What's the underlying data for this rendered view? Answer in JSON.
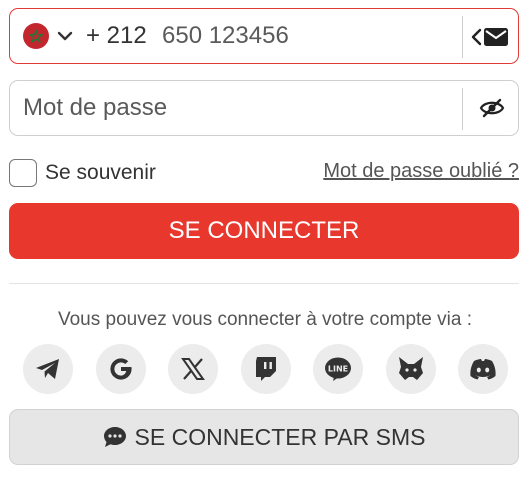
{
  "phone": {
    "country_flag_icon": "morocco-flag-icon",
    "country_code": "+ 212",
    "placeholder": "650 123456",
    "switch_icon": "chevron-left-envelope-icon"
  },
  "password": {
    "placeholder": "Mot de passe",
    "toggle_icon": "eye-off-icon"
  },
  "remember": {
    "label": "Se souvenir",
    "checked": false
  },
  "forgot_link": "Mot de passe oublié ?",
  "login_button": "SE CONNECTER",
  "social_prompt": "Vous pouvez vous connecter à votre compte via :",
  "socials": [
    "telegram-icon",
    "google-icon",
    "x-icon",
    "twitch-icon",
    "line-icon",
    "metamask-icon",
    "discord-icon"
  ],
  "sms_button": {
    "label": "SE CONNECTER PAR SMS",
    "icon": "chat-bubble-icon"
  },
  "colors": {
    "accent": "#e8372d",
    "border_active": "#e23b33",
    "social_bg": "#ececec",
    "sms_bg": "#e6e6e6"
  }
}
